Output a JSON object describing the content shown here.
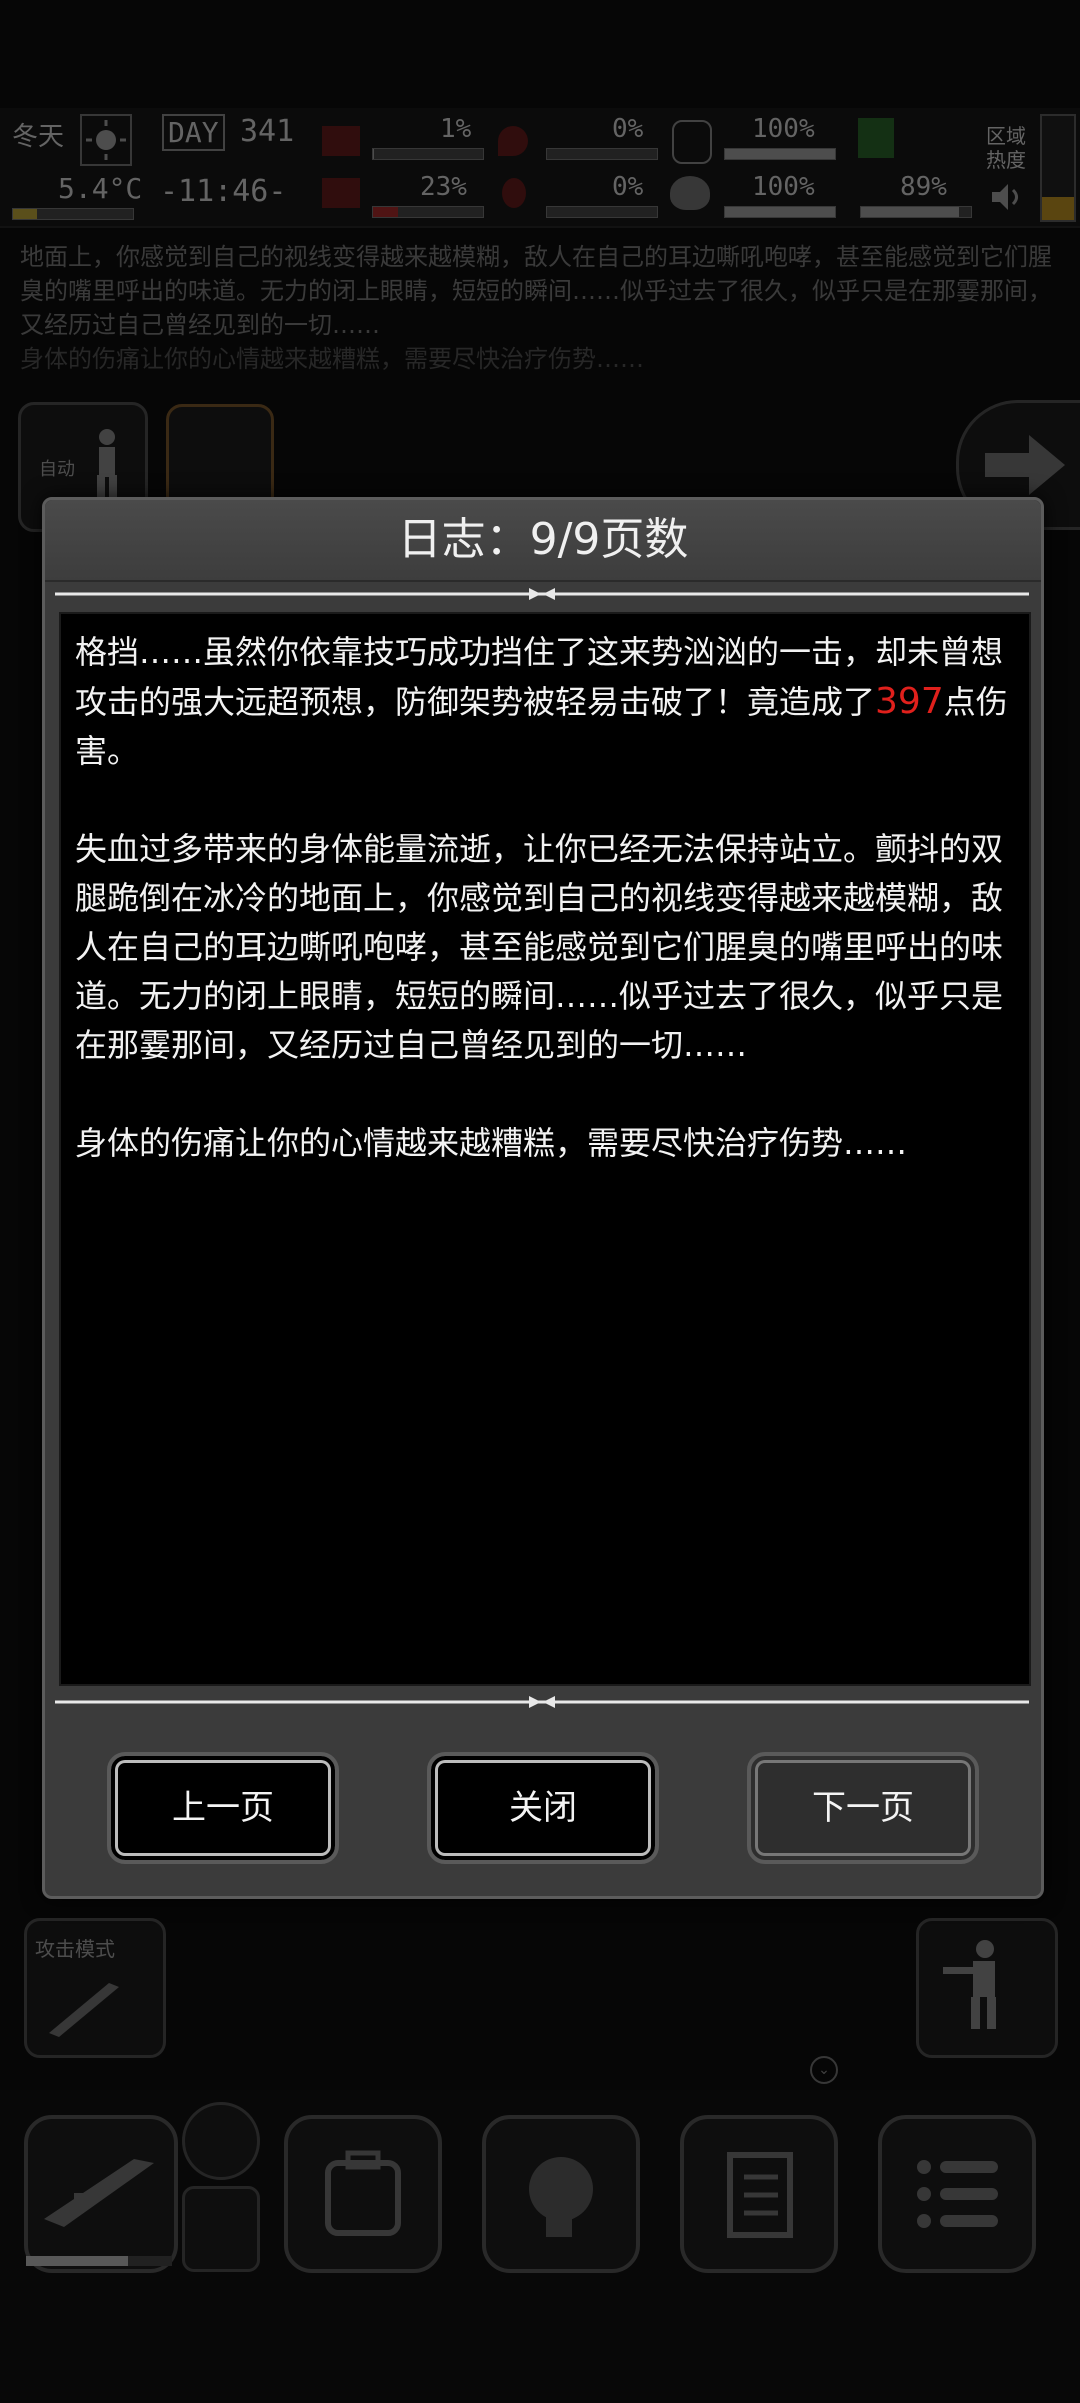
{
  "status": {
    "season": "冬天",
    "temperature": "5.4°C",
    "day_label": "DAY",
    "day_number": "341",
    "time": "-11:46-",
    "stat_hunger": "1%",
    "stat_thirst": "0%",
    "stat_stamina": "100%",
    "stat_health": "23%",
    "stat_blood": "0%",
    "stat_mood": "100%",
    "stat_energy": "89%",
    "zone_heat_label": "区域热度"
  },
  "background_log": {
    "text": "地面上，你感觉到自己的视线变得越来越模糊，敌人在自己的耳边嘶吼咆哮，甚至能感觉到它们腥臭的嘴里呼出的味道。无力的闭上眼睛，短短的瞬间……似乎过去了很久，似乎只是在那霎那间，又经历过自己曾经见到的一切……",
    "text2": "身体的伤痛让你的心情越来越糟糕，需要尽快治疗伤势……"
  },
  "side_buttons": {
    "auto_label": "自动",
    "attack_mode_label": "攻击模式"
  },
  "dialog": {
    "title": "日志：9/9页数",
    "para1_before": "格挡……虽然你依靠技巧成功挡住了这来势汹汹的一击，却未曾想攻击的强大远超预想，防御架势被轻易击破了！竟造成了",
    "damage": "397",
    "para1_after": "点伤害。",
    "para2": "失血过多带来的身体能量流逝，让你已经无法保持站立。颤抖的双腿跪倒在冰冷的地面上，你感觉到自己的视线变得越来越模糊，敌人在自己的耳边嘶吼咆哮，甚至能感觉到它们腥臭的嘴里呼出的味道。无力的闭上眼睛，短短的瞬间……似乎过去了很久，似乎只是在那霎那间，又经历过自己曾经见到的一切……",
    "para3": "身体的伤痛让你的心情越来越糟糕，需要尽快治疗伤势……",
    "prev_label": "上一页",
    "close_label": "关闭",
    "next_label": "下一页"
  },
  "colors": {
    "damage": "#e0201c",
    "dialog_bg": "#3b3b3b"
  }
}
